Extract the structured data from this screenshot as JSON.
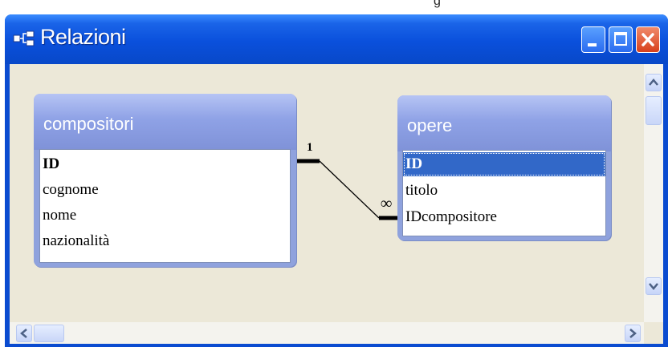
{
  "window": {
    "title": "Relazioni",
    "buttons": {
      "minimize": "Minimize",
      "maximize": "Maximize",
      "close": "Close"
    }
  },
  "top_fragment": {
    "text_left": "g",
    "text_right": ""
  },
  "tables": [
    {
      "name": "compositori",
      "fields": [
        {
          "label": "ID",
          "primary_key": true
        },
        {
          "label": "cognome"
        },
        {
          "label": "nome"
        },
        {
          "label": "nazionalità"
        }
      ]
    },
    {
      "name": "opere",
      "fields": [
        {
          "label": "ID",
          "primary_key": true,
          "selected": true
        },
        {
          "label": "titolo"
        },
        {
          "label": "IDcompositore"
        }
      ]
    }
  ],
  "relationship": {
    "one_label": "1",
    "many_label": "∞"
  },
  "colors": {
    "titlebar": "#0a50dc",
    "canvas": "#ece8d8",
    "table_header": "#8fa2e6",
    "selection": "#3268c8"
  }
}
